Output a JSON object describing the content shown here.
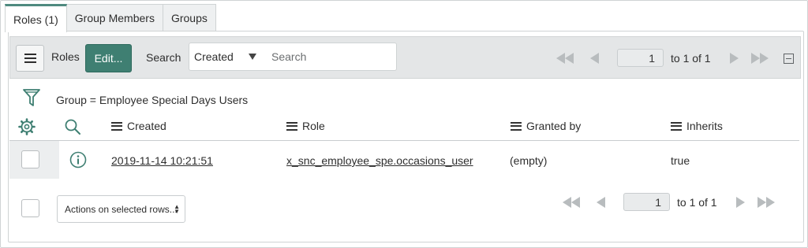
{
  "tabs": [
    {
      "label": "Roles (1)",
      "active": true
    },
    {
      "label": "Group Members",
      "active": false
    },
    {
      "label": "Groups",
      "active": false
    }
  ],
  "toolbar": {
    "list_label": "Roles",
    "edit_label": "Edit...",
    "search_label": "Search",
    "search_field": "Created",
    "search_placeholder": "Search",
    "page_value": "1",
    "page_of": "to 1 of 1"
  },
  "filter": {
    "text": "Group = Employee Special Days Users"
  },
  "table": {
    "columns": [
      "Created",
      "Role",
      "Granted by",
      "Inherits"
    ],
    "rows": [
      {
        "created": "2019-11-14 10:21:51",
        "role": "x_snc_employee_spe.occasions_user",
        "granted_by": "(empty)",
        "inherits": "true"
      }
    ]
  },
  "footer": {
    "actions_label": "Actions on selected rows...",
    "page_value": "1",
    "page_of": "to 1 of 1"
  },
  "colors": {
    "accent": "#3f7f72",
    "icon": "#3f7f72"
  }
}
